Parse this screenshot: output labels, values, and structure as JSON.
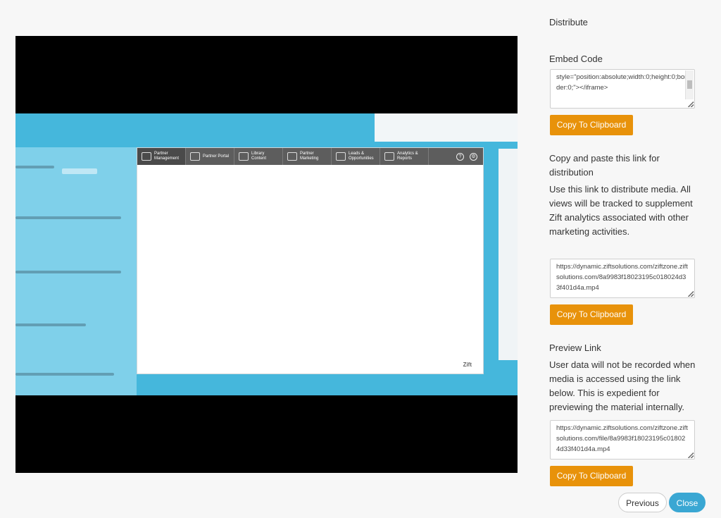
{
  "video": {
    "nav_items": [
      {
        "label": "Partner Management",
        "icon": "people-icon"
      },
      {
        "label": "Partner Portal",
        "icon": "monitor-icon"
      },
      {
        "label": "Library Content",
        "icon": "folder-icon"
      },
      {
        "label": "Partner Marketing",
        "icon": "megaphone-icon"
      },
      {
        "label": "Leads & Opportunities",
        "icon": "funnel-icon"
      },
      {
        "label": "Analytics & Reports",
        "icon": "chart-icon"
      }
    ],
    "right_icons": [
      "help-icon",
      "gear-icon"
    ],
    "watermark": "Zift"
  },
  "distribute": {
    "title": "Distribute",
    "embed_heading": "Embed Code",
    "embed_code": "style=\"position:absolute;width:0;height:0;border:0;\"></iframe>",
    "copy_label": "Copy To Clipboard",
    "link_heading": "Copy and paste this link for distribution",
    "link_description": "Use this link to distribute media. All views will be tracked to supplement Zift analytics associated with other marketing activities.",
    "link_url": "https://dynamic.ziftsolutions.com/ziftzone.ziftsolutions.com/8a9983f18023195c018024d33f401d4a.mp4",
    "preview_heading": "Preview Link",
    "preview_description": "User data will not be recorded when media is accessed using the link below. This is expedient for previewing the material internally.",
    "preview_url": "https://dynamic.ziftsolutions.com/ziftzone.ziftsolutions.com/file/8a9983f18023195c018024d33f401d4a.mp4"
  },
  "footer": {
    "previous_label": "Previous",
    "close_label": "Close"
  },
  "colors": {
    "button_orange": "#e8920a",
    "close_blue": "#3aa7d3",
    "video_cyan": "#45b7dc"
  }
}
